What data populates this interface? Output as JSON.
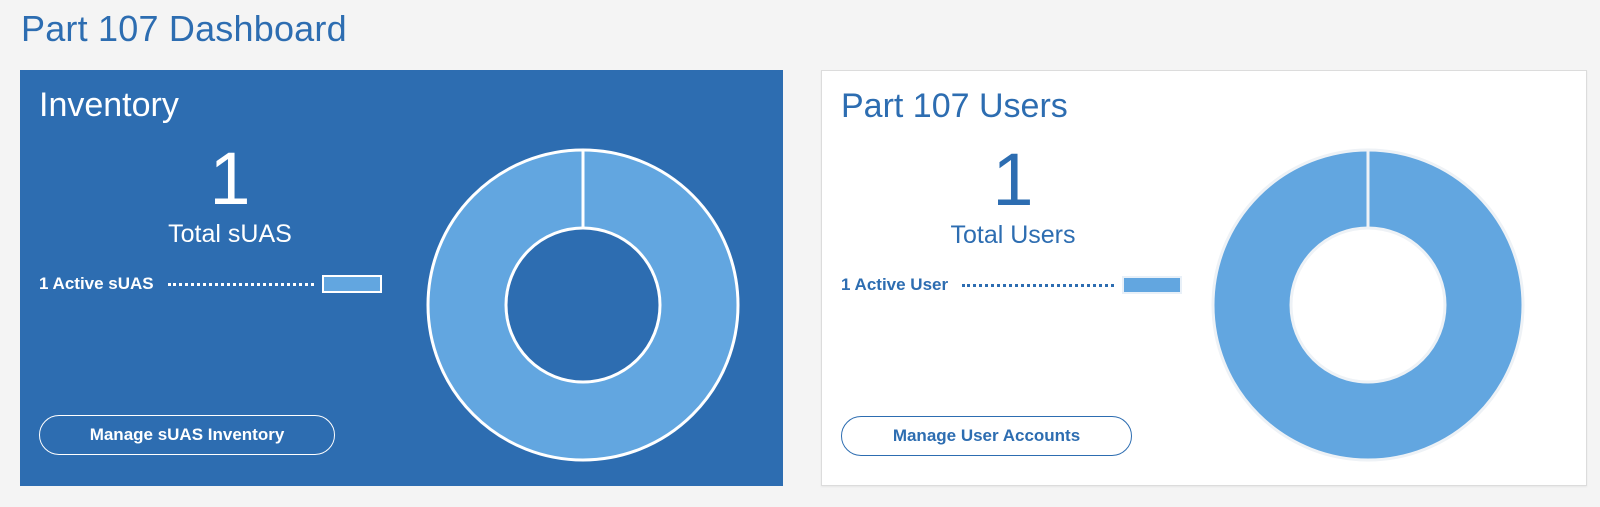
{
  "page": {
    "title": "Part 107 Dashboard"
  },
  "inventory": {
    "title": "Inventory",
    "total_value": "1",
    "total_label": "Total sUAS",
    "legend_label": "1 Active sUAS",
    "button_label": "Manage sUAS Inventory"
  },
  "users": {
    "title": "Part 107 Users",
    "total_value": "1",
    "total_label": "Total Users",
    "legend_label": "1 Active User",
    "button_label": "Manage User Accounts"
  },
  "colors": {
    "brand": "#2d6db1",
    "segment": "#62a6e0",
    "card_light": "#ffffff"
  },
  "chart_data": [
    {
      "type": "pie",
      "categories": [
        "Active sUAS"
      ],
      "values": [
        1
      ]
    },
    {
      "type": "pie",
      "categories": [
        "Active User"
      ],
      "values": [
        1
      ]
    }
  ]
}
